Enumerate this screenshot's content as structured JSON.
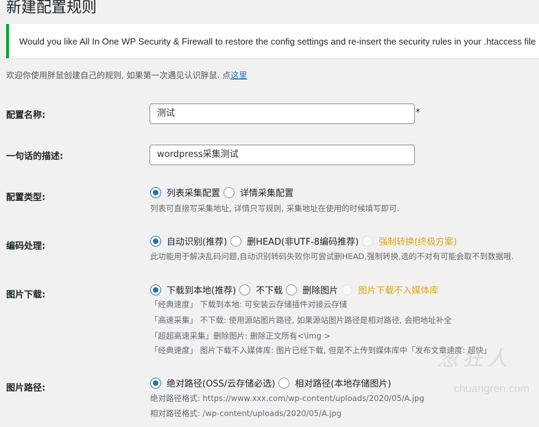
{
  "page": {
    "title": "新建配置规则"
  },
  "notice": {
    "text": "Would you like All In One WP Security & Firewall to restore the config settings and re-insert the security rules in your .htaccess file"
  },
  "intro": {
    "text": "欢迎你使用胖鼠创建自己的规则, 如果第一次遇见认识胖鼠. 点",
    "link": "这里"
  },
  "config_name": {
    "label": "配置名称:",
    "value": "测试",
    "required_mark": "*"
  },
  "description": {
    "label": "一句话的描述:",
    "value": "wordpress采集测试"
  },
  "config_type": {
    "label": "配置类型:",
    "options": [
      "列表采集配置",
      "详情采集配置"
    ],
    "selected_index": 0,
    "help": "列表可直接写采集地址, 详情只写规则, 采集地址在使用的时候填写即可."
  },
  "encoding": {
    "label": "编码处理:",
    "options": [
      "自动识别(推荐)",
      "删HEAD(非UTF-8编码推荐)",
      "强制转换(终极方案)"
    ],
    "selected_index": 0,
    "help": "此功能用于解决乱码问题,自动识别转码失败你可尝试删HEAD,强制转换,选的不对有可能会取不到数据哦."
  },
  "image_download": {
    "label": "图片下载:",
    "options": [
      "下载到本地(推荐)",
      "不下载",
      "删除图片",
      "图片下载不入媒体库"
    ],
    "selected_index": 0,
    "notes": [
      "「经典速度」 下载到本地: 可安装云存储插件对接云存储",
      "「高速采集」 不下载: 使用源站图片路径, 如果源站图片路径是相对路径, 会把地址补全",
      "「超超高速采集」删除图片: 删除正文所有<\\img >",
      "「经典速度」 图片下载不入媒体库: 图片已经下载, 但是不上传到媒体库中「发布文章速度: 超快」"
    ]
  },
  "image_path": {
    "label": "图片路径:",
    "options": [
      "绝对路径(OSS/云存储必选)",
      "相对路径(本地存储图片)"
    ],
    "selected_index": 0,
    "notes": [
      "绝对路径格式: https://www.xxx.com/wp-content/uploads/2020/05/A.jpg",
      "相对路径格式: /wp-content/uploads/2020/05/A.jpg"
    ]
  },
  "watermark": {
    "text": "葱狂人",
    "sub": "chuangren.com"
  },
  "colors": {
    "accent": "#2271b1",
    "notice_border": "#00a32a",
    "highlight_option": "#dba617"
  }
}
